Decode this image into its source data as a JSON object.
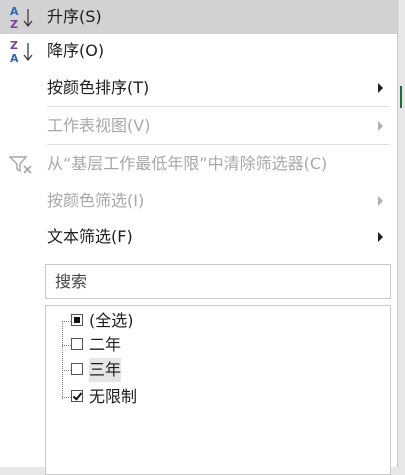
{
  "menu": {
    "sort_asc": "升序(S)",
    "sort_desc": "降序(O)",
    "sort_by_color": "按颜色排序(T)",
    "sheet_view": "工作表视图(V)",
    "clear_filter": "从“基层工作最低年限”中清除筛选器(C)",
    "filter_by_color": "按颜色筛选(I)",
    "text_filter": "文本筛选(F)"
  },
  "search": {
    "placeholder": "搜索"
  },
  "list": {
    "items": [
      {
        "label": "(全选)",
        "state": "partial"
      },
      {
        "label": "二年",
        "state": "unchecked"
      },
      {
        "label": "三年",
        "state": "unchecked"
      },
      {
        "label": "无限制",
        "state": "checked"
      }
    ]
  },
  "colors": {
    "hover": "#d2d2d2",
    "disabled_text": "#a8a8a8",
    "az_purple": "#7b3fa0",
    "az_blue": "#2e6bb5"
  },
  "icons": {
    "sort_asc": "sort-ascending-icon",
    "sort_desc": "sort-descending-icon",
    "clear_filter": "clear-filter-icon"
  }
}
